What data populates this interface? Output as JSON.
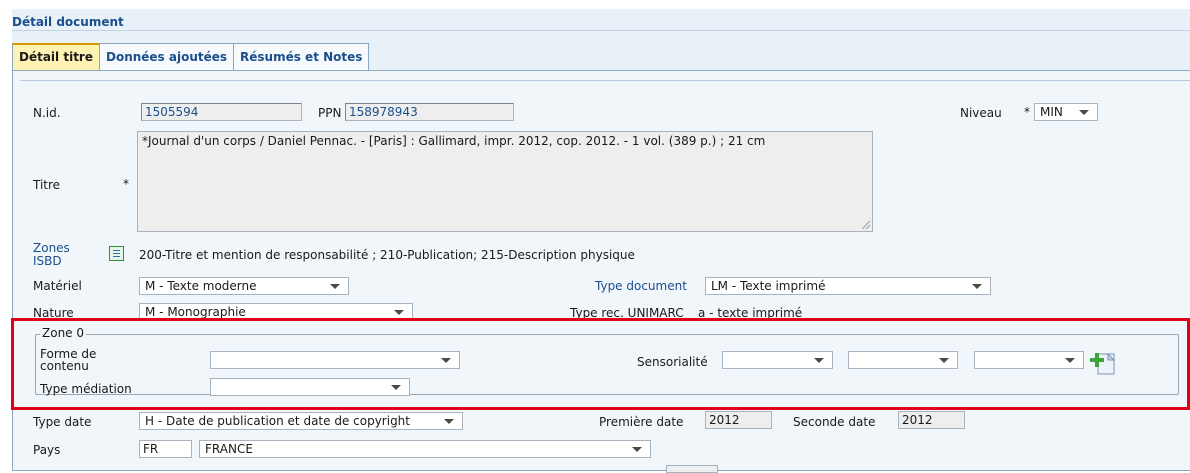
{
  "section": {
    "title": "Détail document"
  },
  "tabs": [
    {
      "label": "Détail titre",
      "active": true
    },
    {
      "label": "Données ajoutées",
      "active": false
    },
    {
      "label": "Résumés et Notes",
      "active": false
    }
  ],
  "nid": {
    "label": "N.id.",
    "value": "1505594"
  },
  "ppn": {
    "label": "PPN",
    "value": "158978943"
  },
  "niveau": {
    "label": "Niveau",
    "required": "*",
    "value": "MIN"
  },
  "titre": {
    "label": "Titre",
    "required": "*",
    "value": "*Journal d'un corps / Daniel Pennac. - [Paris] : Gallimard, impr. 2012, cop. 2012. - 1 vol. (389 p.) ; 21 cm"
  },
  "zones_isbd": {
    "label_line1": "Zones",
    "label_line2": "ISBD",
    "icon": "list-icon",
    "value": "200-Titre et mention de responsabilité ; 210-Publication; 215-Description physique"
  },
  "materiel": {
    "label": "Matériel",
    "value": "M - Texte moderne"
  },
  "type_document": {
    "label": "Type document",
    "value": "LM - Texte imprimé"
  },
  "nature": {
    "label": "Nature",
    "value": "M - Monographie"
  },
  "type_rec": {
    "label": "Type rec. UNIMARC",
    "value": "a - texte imprimé"
  },
  "zone0": {
    "legend": "Zone 0",
    "forme_label_line1": "Forme de",
    "forme_label_line2": "contenu",
    "forme_value": "",
    "type_mediation_label": "Type médiation",
    "type_mediation_value": "",
    "sensorialite_label": "Sensorialité",
    "sensorialite_values": [
      "",
      "",
      ""
    ],
    "add_icon": "add-page-icon"
  },
  "type_date": {
    "label": "Type date",
    "value": "H - Date de publication et date de copyright"
  },
  "premiere_date": {
    "label": "Première date",
    "value": "2012"
  },
  "seconde_date": {
    "label": "Seconde date",
    "value": "2012"
  },
  "pays": {
    "label": "Pays",
    "code": "FR",
    "value": "FRANCE"
  },
  "colors": {
    "accent": "#1b4f8c",
    "highlight": "#e0001a",
    "active_tab": "#fff3b3"
  }
}
